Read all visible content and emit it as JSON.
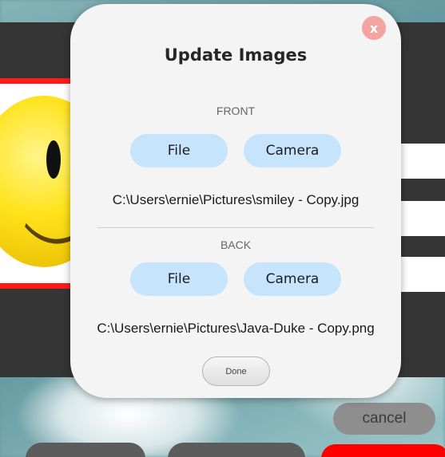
{
  "dialog": {
    "title": "Update Images",
    "close_label": "x",
    "front": {
      "label": "FRONT",
      "file_label": "File",
      "camera_label": "Camera",
      "path": "C:\\Users\\ernie\\Pictures\\smiley - Copy.jpg"
    },
    "back": {
      "label": "BACK",
      "file_label": "File",
      "camera_label": "Camera",
      "path": "C:\\Users\\ernie\\Pictures\\Java-Duke - Copy.png"
    },
    "done_label": "Done"
  },
  "background": {
    "cancel_label": "cancel"
  },
  "colors": {
    "dialog_bg": "#f4f4f4",
    "pick_button": "#c6e4fb",
    "close_button": "#f4a3a3",
    "cancel_button": "#8e8e8e",
    "accent_red": "#ff0000"
  },
  "icons": {
    "close": "close-icon"
  }
}
